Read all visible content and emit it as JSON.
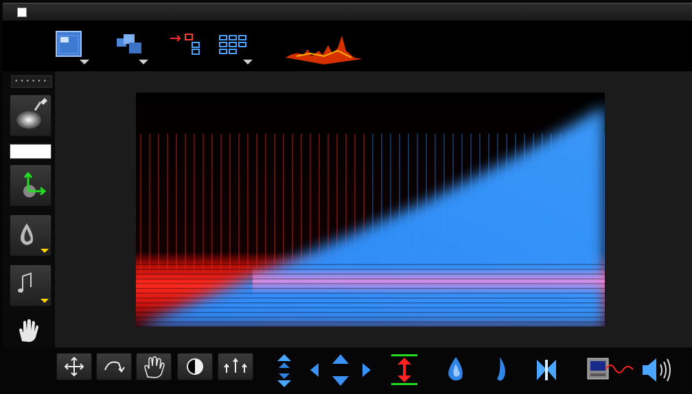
{
  "window": {
    "title": ""
  },
  "toolbar": {
    "items": [
      "view-options-icon",
      "window-layout-icon",
      "link-instrument-icon",
      "grid-view-icon",
      "waveform-thumbnail"
    ]
  },
  "sidebar": {
    "dots_label": "••••••",
    "items": [
      "brush-icon",
      "color-swatch",
      "axes-icon",
      "ink-drop-icon",
      "music-note-icon",
      "hand-icon",
      "scale-icon"
    ]
  },
  "spectrogram": {
    "colors": {
      "left": "#ff2a1f",
      "right": "#2a8cff",
      "highlight": "#ff8ee0",
      "background": "#000000"
    }
  },
  "bottombar": {
    "items": [
      "move-icon",
      "rotate-icon",
      "grab-hand-icon",
      "contrast-icon",
      "expand-icon",
      "vertical-zoom-icon",
      "pan-arrows-icon",
      "height-adjust-icon",
      "drop-icon",
      "flame-icon",
      "bowtie-icon",
      "monitor-waveform-icon",
      "speaker-icon"
    ]
  }
}
